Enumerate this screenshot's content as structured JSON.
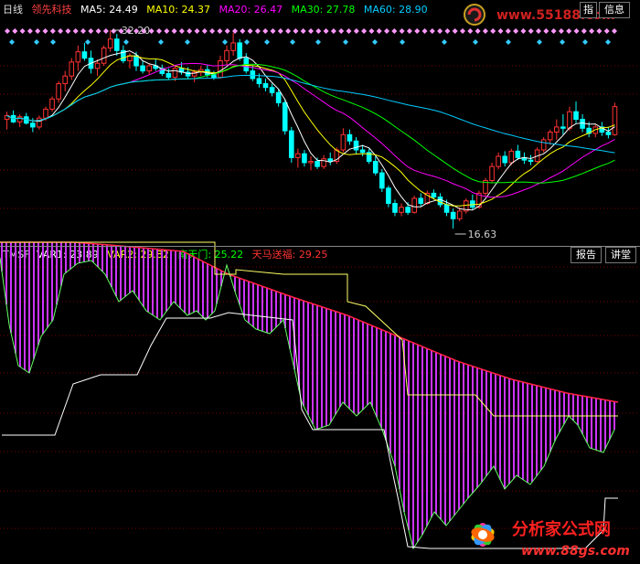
{
  "top_header": {
    "period": "日线",
    "stock": "领先科技",
    "ma": [
      {
        "label": "MA5:",
        "value": "24.49",
        "color": "#ffffff"
      },
      {
        "label": "MA10:",
        "value": "24.37",
        "color": "#ffff00"
      },
      {
        "label": "MA20:",
        "value": "26.47",
        "color": "#ff00ff"
      },
      {
        "label": "MA30:",
        "value": "27.78",
        "color": "#00ff00"
      },
      {
        "label": "MA60:",
        "value": "28.90",
        "color": "#00ccff"
      }
    ],
    "info_buttons": [
      "指",
      "信息"
    ]
  },
  "bottom_header": {
    "indicator": "TMSF",
    "vars": [
      {
        "label": "VAR1:",
        "value": "23.89",
        "color": "#ffffff"
      },
      {
        "label": "VAR2:",
        "value": "29.82",
        "color": "#ffff00"
      },
      {
        "label": "南天门:",
        "value": "25.22",
        "color": "#00ff00"
      },
      {
        "label": "天马送福:",
        "value": "29.25",
        "color": "#ff3333"
      }
    ],
    "buttons": [
      "报告",
      "讲堂"
    ]
  },
  "watermark_top": "www.55188.com",
  "watermark_bottom": {
    "title": "分析家公式网",
    "url": "www.88gs.com"
  },
  "chart_data": [
    {
      "type": "candlestick",
      "annotations": {
        "high": "32.20",
        "low": "16.63"
      },
      "ohlc": [
        [
          25.2,
          25.8,
          24.4,
          25.5
        ],
        [
          25.5,
          25.9,
          24.9,
          25.0
        ],
        [
          25.0,
          25.6,
          24.6,
          25.4
        ],
        [
          25.4,
          25.7,
          24.8,
          24.9
        ],
        [
          24.9,
          25.3,
          24.2,
          24.6
        ],
        [
          24.6,
          25.5,
          24.4,
          25.3
        ],
        [
          25.3,
          26.2,
          25.1,
          26.0
        ],
        [
          26.0,
          27.0,
          25.8,
          26.8
        ],
        [
          26.8,
          28.2,
          26.5,
          28.0
        ],
        [
          28.0,
          29.0,
          27.4,
          28.6
        ],
        [
          28.6,
          30.0,
          28.3,
          29.7
        ],
        [
          29.7,
          31.0,
          29.0,
          30.5
        ],
        [
          30.5,
          31.2,
          29.8,
          30.0
        ],
        [
          30.0,
          30.6,
          28.8,
          29.2
        ],
        [
          29.2,
          29.9,
          28.6,
          29.6
        ],
        [
          29.6,
          31.0,
          29.4,
          30.8
        ],
        [
          30.8,
          32.2,
          30.5,
          31.5
        ],
        [
          31.5,
          31.9,
          30.2,
          30.6
        ],
        [
          30.6,
          31.0,
          29.6,
          29.8
        ],
        [
          29.8,
          30.4,
          29.2,
          30.2
        ],
        [
          30.2,
          30.5,
          29.0,
          29.4
        ],
        [
          29.4,
          29.8,
          28.8,
          29.0
        ],
        [
          29.0,
          29.6,
          28.7,
          29.4
        ],
        [
          29.4,
          29.9,
          29.0,
          29.2
        ],
        [
          29.2,
          29.5,
          28.6,
          28.8
        ],
        [
          28.8,
          29.2,
          28.3,
          28.5
        ],
        [
          28.5,
          29.4,
          28.2,
          29.2
        ],
        [
          29.2,
          29.7,
          28.7,
          28.9
        ],
        [
          28.9,
          29.3,
          28.4,
          28.6
        ],
        [
          28.6,
          29.1,
          28.1,
          28.9
        ],
        [
          28.9,
          29.4,
          28.6,
          29.1
        ],
        [
          29.1,
          29.5,
          28.5,
          28.7
        ],
        [
          28.7,
          29.0,
          28.3,
          28.5
        ],
        [
          28.5,
          30.2,
          28.4,
          29.8
        ],
        [
          29.8,
          31.0,
          29.5,
          30.6
        ],
        [
          30.6,
          32.0,
          30.2,
          31.2
        ],
        [
          31.2,
          31.5,
          29.8,
          30.0
        ],
        [
          30.0,
          30.4,
          28.8,
          29.0
        ],
        [
          29.0,
          29.4,
          28.2,
          28.4
        ],
        [
          28.4,
          28.8,
          27.7,
          28.0
        ],
        [
          28.0,
          28.4,
          27.4,
          27.7
        ],
        [
          27.7,
          28.0,
          27.0,
          27.3
        ],
        [
          27.3,
          27.6,
          26.2,
          26.5
        ],
        [
          26.5,
          26.8,
          24.0,
          24.3
        ],
        [
          24.3,
          24.6,
          21.8,
          22.2
        ],
        [
          22.2,
          22.9,
          21.4,
          22.5
        ],
        [
          22.5,
          22.8,
          21.5,
          21.8
        ],
        [
          21.8,
          22.3,
          21.2,
          21.9
        ],
        [
          21.9,
          22.2,
          21.3,
          21.5
        ],
        [
          21.5,
          22.4,
          21.3,
          22.1
        ],
        [
          22.1,
          22.6,
          21.6,
          21.9
        ],
        [
          21.9,
          23.0,
          21.7,
          22.8
        ],
        [
          22.8,
          24.5,
          22.6,
          24.0
        ],
        [
          24.0,
          24.4,
          23.2,
          23.5
        ],
        [
          23.5,
          23.8,
          22.5,
          22.8
        ],
        [
          22.8,
          23.2,
          22.3,
          22.6
        ],
        [
          22.6,
          22.9,
          21.7,
          21.9
        ],
        [
          21.9,
          22.3,
          20.8,
          21.0
        ],
        [
          21.0,
          21.3,
          19.5,
          19.8
        ],
        [
          19.8,
          20.0,
          18.3,
          18.6
        ],
        [
          18.6,
          18.9,
          17.6,
          17.9
        ],
        [
          17.9,
          18.6,
          17.6,
          18.3
        ],
        [
          18.3,
          18.7,
          17.7,
          17.9
        ],
        [
          17.9,
          19.2,
          17.8,
          19.0
        ],
        [
          19.0,
          19.4,
          18.4,
          18.6
        ],
        [
          18.6,
          19.6,
          18.5,
          19.4
        ],
        [
          19.4,
          19.7,
          18.9,
          19.1
        ],
        [
          19.1,
          19.4,
          18.3,
          18.5
        ],
        [
          18.5,
          18.9,
          17.6,
          17.9
        ],
        [
          17.9,
          18.2,
          16.63,
          17.4
        ],
        [
          17.4,
          18.3,
          17.2,
          18.0
        ],
        [
          18.0,
          19.0,
          17.8,
          18.8
        ],
        [
          18.8,
          19.3,
          18.1,
          18.3
        ],
        [
          18.3,
          19.6,
          18.2,
          19.4
        ],
        [
          19.4,
          20.6,
          19.2,
          20.4
        ],
        [
          20.4,
          21.8,
          20.2,
          21.5
        ],
        [
          21.5,
          22.6,
          21.3,
          22.3
        ],
        [
          22.3,
          22.7,
          21.5,
          21.8
        ],
        [
          21.8,
          22.9,
          21.6,
          22.7
        ],
        [
          22.7,
          23.2,
          22.0,
          22.2
        ],
        [
          22.2,
          22.6,
          21.7,
          22.0
        ],
        [
          22.0,
          22.4,
          21.6,
          21.9
        ],
        [
          21.9,
          23.0,
          21.8,
          22.8
        ],
        [
          22.8,
          23.8,
          22.6,
          23.6
        ],
        [
          23.6,
          24.4,
          23.2,
          24.2
        ],
        [
          24.2,
          25.2,
          23.6,
          24.6
        ],
        [
          24.6,
          25.6,
          24.0,
          24.5
        ],
        [
          24.5,
          26.2,
          24.3,
          25.8
        ],
        [
          25.8,
          26.6,
          24.9,
          25.2
        ],
        [
          25.2,
          25.6,
          24.2,
          24.5
        ],
        [
          24.5,
          25.0,
          23.8,
          24.1
        ],
        [
          24.1,
          24.8,
          23.8,
          24.6
        ],
        [
          24.6,
          25.0,
          23.9,
          24.2
        ],
        [
          24.2,
          24.6,
          23.7,
          24.0
        ],
        [
          24.0,
          26.5,
          23.9,
          26.2
        ]
      ]
    },
    {
      "type": "line",
      "series_names": [
        "VAR1",
        "VAR2",
        "南天门",
        "天马送福"
      ]
    }
  ]
}
